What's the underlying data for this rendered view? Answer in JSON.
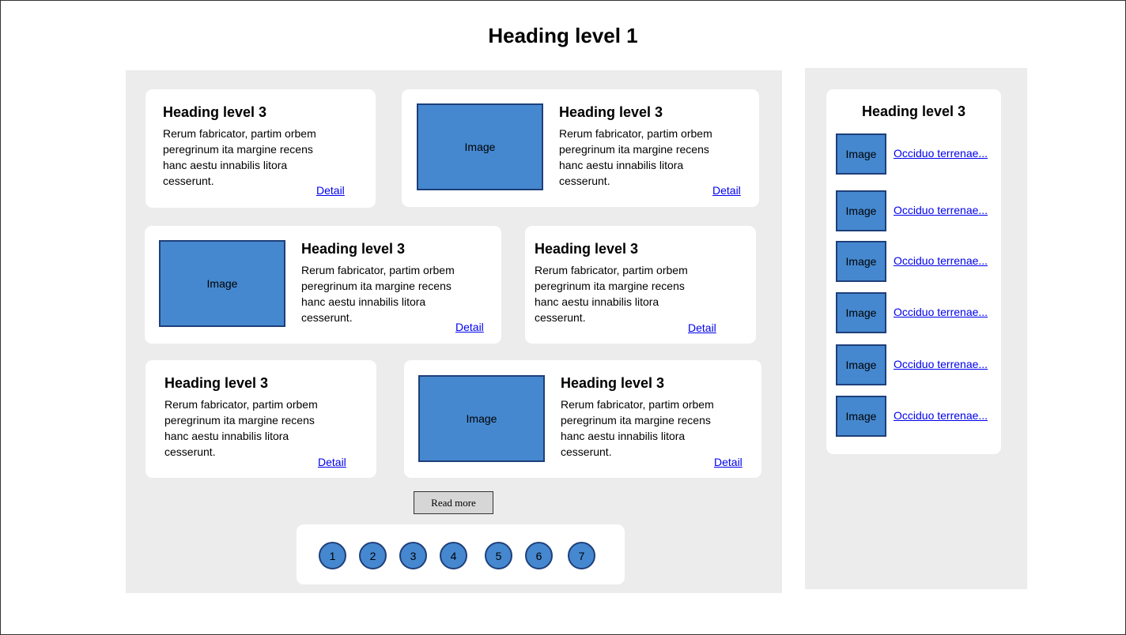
{
  "page": {
    "title": "Heading level 1"
  },
  "cards": [
    {
      "heading": "Heading level 3",
      "body": "Rerum fabricator, partim orbem peregrinum ita margine recens hanc aestu innabilis litora cesserunt.",
      "link": "Detail",
      "image": null
    },
    {
      "heading": "Heading level 3",
      "body": "Rerum fabricator, partim orbem peregrinum ita margine recens hanc aestu innabilis litora cesserunt.",
      "link": "Detail",
      "image": "Image"
    },
    {
      "heading": "Heading level 3",
      "body": "Rerum fabricator, partim orbem peregrinum ita margine recens hanc aestu innabilis litora cesserunt.",
      "link": "Detail",
      "image": "Image"
    },
    {
      "heading": "Heading level 3",
      "body": "Rerum fabricator, partim orbem peregrinum ita margine recens hanc aestu innabilis litora cesserunt.",
      "link": "Detail",
      "image": null
    },
    {
      "heading": "Heading level 3",
      "body": "Rerum fabricator, partim orbem peregrinum ita margine recens hanc aestu innabilis litora cesserunt.",
      "link": "Detail",
      "image": null
    },
    {
      "heading": "Heading level 3",
      "body": "Rerum fabricator, partim orbem peregrinum ita margine recens hanc aestu innabilis litora cesserunt.",
      "link": "Detail",
      "image": "Image"
    }
  ],
  "read_more": "Read more",
  "pagination": [
    "1",
    "2",
    "3",
    "4",
    "5",
    "6",
    "7"
  ],
  "sidebar": {
    "heading": "Heading level 3",
    "items": [
      {
        "image": "Image",
        "link": "Occiduo terrenae..."
      },
      {
        "image": "Image",
        "link": "Occiduo terrenae..."
      },
      {
        "image": "Image",
        "link": "Occiduo terrenae..."
      },
      {
        "image": "Image",
        "link": "Occiduo terrenae..."
      },
      {
        "image": "Image",
        "link": "Occiduo terrenae..."
      },
      {
        "image": "Image",
        "link": "Occiduo terrenae..."
      }
    ]
  },
  "colors": {
    "image_fill": "#4588cf",
    "image_border": "#1f3f7a",
    "panel_bg": "#ececec",
    "link": "#0000ee"
  }
}
